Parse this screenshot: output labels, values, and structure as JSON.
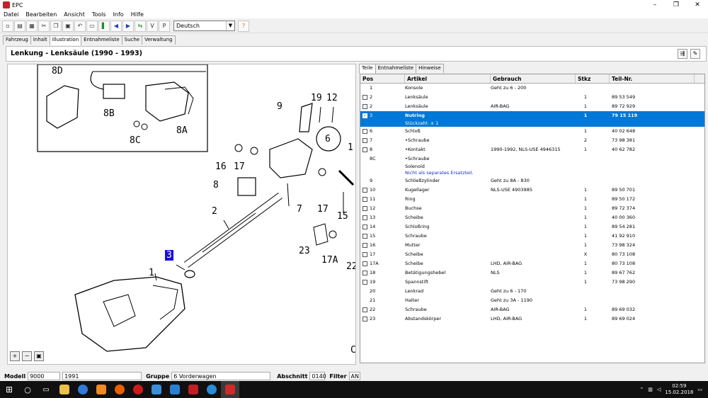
{
  "window": {
    "title": "EPC",
    "controls": [
      "–",
      "❐",
      "✕"
    ]
  },
  "menu": [
    "Datei",
    "Bearbeiten",
    "Ansicht",
    "Tools",
    "Info",
    "Hilfe"
  ],
  "toolbar": {
    "language": "Deutsch"
  },
  "top_tabs": [
    "Fahrzeug",
    "Inhalt",
    "Illustration",
    "Entnahmeliste",
    "Suche",
    "Verwaltung"
  ],
  "top_tabs_active": "Illustration",
  "section": {
    "title": "Lenkung - Lenksäule  (1990 - 1993)"
  },
  "illustration": {
    "callouts": [
      "8D",
      "8B",
      "8C",
      "8A",
      "9",
      "19",
      "12",
      "6",
      "1",
      "16",
      "17",
      "8",
      "7",
      "2",
      "17",
      "15",
      "3",
      "23",
      "17A",
      "22",
      "1",
      "C"
    ],
    "highlighted": "3"
  },
  "right_tabs": [
    "Teile",
    "Entnahmeliste",
    "Hinweise"
  ],
  "right_tabs_active": "Teile",
  "columns": [
    "Pos",
    "Artikel",
    "Gebrauch",
    "Stkz",
    "Teil-Nr."
  ],
  "rows": [
    {
      "pos": "1",
      "artikel": "Konsole",
      "gebrauch": "Geht zu 6 - 200",
      "stkz": "",
      "teil": "",
      "checkbox": false
    },
    {
      "pos": "2",
      "artikel": "Lenksäule",
      "gebrauch": "",
      "stkz": "1",
      "teil": "89 53 549",
      "checkbox": true
    },
    {
      "pos": "2",
      "artikel": "Lenksäule",
      "gebrauch": "AIR-BAG",
      "stkz": "1",
      "teil": "89 72 929",
      "checkbox": true
    },
    {
      "pos": "3",
      "artikel": "Nutring",
      "sub": "Stückzahl: ± 1",
      "gebrauch": "",
      "stkz": "1",
      "teil": "79 15 119",
      "checkbox": true,
      "selected": true
    },
    {
      "pos": "6",
      "artikel": "Schloß",
      "gebrauch": "",
      "stkz": "1",
      "teil": "40 02 648",
      "checkbox": true
    },
    {
      "pos": "7",
      "artikel": "•Schraube",
      "gebrauch": "",
      "stkz": "2",
      "teil": "73 98 381",
      "checkbox": true
    },
    {
      "pos": "8",
      "artikel": "•Kontakt",
      "gebrauch": "1990-1992, NLS-USE 4946315",
      "stkz": "1",
      "teil": "40 62 782",
      "checkbox": true
    },
    {
      "pos": "8C",
      "artikel": "•Schraube",
      "sub": "Solenoid",
      "note": "Nicht als separates Ersatzteil.",
      "gebrauch": "",
      "stkz": "",
      "teil": "",
      "checkbox": false
    },
    {
      "pos": "9",
      "artikel": "Schließzylinder",
      "gebrauch": "Geht zu 8A - 830",
      "stkz": "",
      "teil": "",
      "checkbox": false
    },
    {
      "pos": "10",
      "artikel": "Kugellager",
      "gebrauch": "NLS-USE 4903985",
      "stkz": "1",
      "teil": "89 50 701",
      "checkbox": true
    },
    {
      "pos": "11",
      "artikel": "Ring",
      "gebrauch": "",
      "stkz": "1",
      "teil": "89 50 172",
      "checkbox": true
    },
    {
      "pos": "12",
      "artikel": "Buchse",
      "gebrauch": "",
      "stkz": "1",
      "teil": "89 72 374",
      "checkbox": true
    },
    {
      "pos": "13",
      "artikel": "Scheibe",
      "gebrauch": "",
      "stkz": "1",
      "teil": "40 00 360",
      "checkbox": true
    },
    {
      "pos": "14",
      "artikel": "Schloßring",
      "gebrauch": "",
      "stkz": "1",
      "teil": "89 54 281",
      "checkbox": true
    },
    {
      "pos": "15",
      "artikel": "Schraube",
      "gebrauch": "",
      "stkz": "1",
      "teil": "41 92 910",
      "checkbox": true
    },
    {
      "pos": "16",
      "artikel": "Mutter",
      "gebrauch": "",
      "stkz": "1",
      "teil": "73 98 324",
      "checkbox": true
    },
    {
      "pos": "17",
      "artikel": "Scheibe",
      "gebrauch": "",
      "stkz": "X",
      "teil": "80 73 108",
      "checkbox": true
    },
    {
      "pos": "17A",
      "artikel": "Scheibe",
      "gebrauch": "LHD, AIR-BAG",
      "stkz": "1",
      "teil": "80 73 108",
      "checkbox": true
    },
    {
      "pos": "18",
      "artikel": "Betätigungshebel",
      "gebrauch": "NLS",
      "stkz": "1",
      "teil": "89 67 762",
      "checkbox": true
    },
    {
      "pos": "19",
      "artikel": "Spannstift",
      "gebrauch": "",
      "stkz": "1",
      "teil": "73 98 290",
      "checkbox": true
    },
    {
      "pos": "20",
      "artikel": "Lenkrad",
      "gebrauch": "Geht zu 6 - 170",
      "stkz": "",
      "teil": "",
      "checkbox": false
    },
    {
      "pos": "21",
      "artikel": "Halter",
      "gebrauch": "Geht zu 3A - 1190",
      "stkz": "",
      "teil": "",
      "checkbox": false
    },
    {
      "pos": "22",
      "artikel": "Schraube",
      "gebrauch": "AIR-BAG",
      "stkz": "1",
      "teil": "89 69 032",
      "checkbox": true
    },
    {
      "pos": "23",
      "artikel": "Abstandskörper",
      "gebrauch": "LHD, AIR-BAG",
      "stkz": "1",
      "teil": "89 69 024",
      "checkbox": true
    }
  ],
  "status": {
    "modell_label": "Modell",
    "modell": "9000",
    "jahr": "1991",
    "gruppe_label": "Gruppe",
    "gruppe": "6 Vorderwagen",
    "abschnitt_label": "Abschnitt",
    "abschnitt": "0140",
    "filter_label": "Filter",
    "filter": "AN"
  },
  "taskbar": {
    "time": "02:59",
    "date": "15.02.2018"
  },
  "colors": {
    "selection": "#0078d7",
    "highlight_callout": "#1a0ddb",
    "note": "#1a2dbf"
  }
}
